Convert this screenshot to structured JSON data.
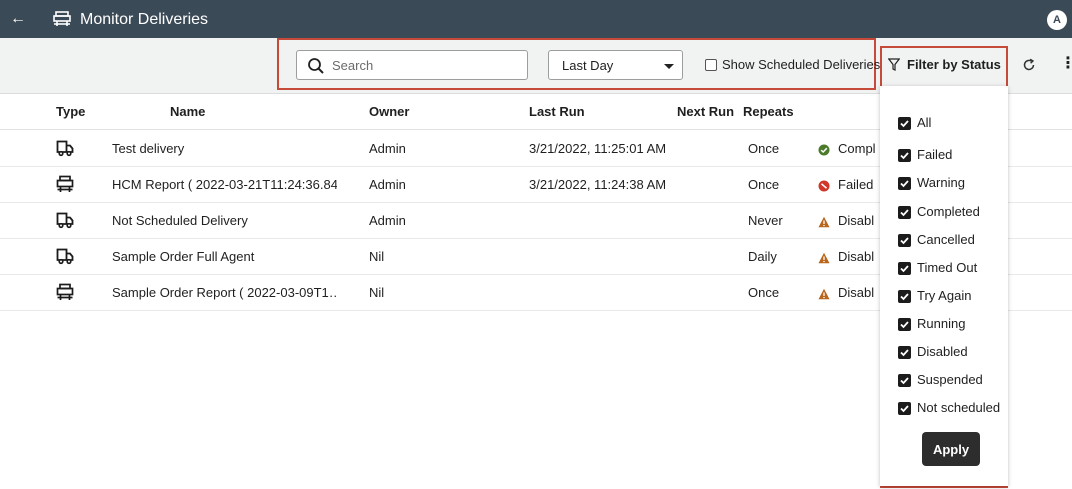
{
  "header": {
    "back_glyph": "←",
    "title": "Monitor Deliveries",
    "avatar_initial": "A"
  },
  "toolbar": {
    "search_placeholder": "Search",
    "time_range": "Last Day",
    "show_scheduled_label": "Show Scheduled Deliveries",
    "show_scheduled_checked": false,
    "filter_label": "Filter by Status",
    "more_glyph": "⋮"
  },
  "table": {
    "columns": [
      "Type",
      "Name",
      "Owner",
      "Last Run",
      "Next Run",
      "Repeats"
    ],
    "rows": [
      {
        "type_icon": "truck-icon",
        "name": "Test delivery",
        "owner": "Admin",
        "last_run": "3/21/2022, 11:25:01 AM",
        "next_run": "",
        "repeats": "Once",
        "status": "Compl",
        "status_icon": "check-circle-icon",
        "status_color": "#4a7a2a"
      },
      {
        "type_icon": "report-icon",
        "name": "HCM Report ( 2022-03-21T11:24:36.84…",
        "owner": "Admin",
        "last_run": "3/21/2022, 11:24:38 AM",
        "next_run": "",
        "repeats": "Once",
        "status": "Failed",
        "status_icon": "error-circle-icon",
        "status_color": "#d1362a"
      },
      {
        "type_icon": "truck-icon",
        "name": "Not Scheduled Delivery",
        "owner": "Admin",
        "last_run": "",
        "next_run": "",
        "repeats": "Never",
        "status": "Disabl",
        "status_icon": "warning-icon",
        "status_color": "#b8661b"
      },
      {
        "type_icon": "truck-icon",
        "name": "Sample Order Full Agent",
        "owner": "Nil",
        "last_run": "",
        "next_run": "",
        "repeats": "Daily",
        "status": "Disabl",
        "status_icon": "warning-icon",
        "status_color": "#b8661b"
      },
      {
        "type_icon": "report-icon",
        "name": "Sample Order Report ( 2022-03-09T1…",
        "owner": "Nil",
        "last_run": "",
        "next_run": "",
        "repeats": "Once",
        "status": "Disabl",
        "status_icon": "warning-icon",
        "status_color": "#b8661b"
      }
    ]
  },
  "filter_menu": {
    "options": [
      {
        "label": "All",
        "checked": true
      },
      {
        "label": "Failed",
        "checked": true
      },
      {
        "label": "Warning",
        "checked": true
      },
      {
        "label": "Completed",
        "checked": true
      },
      {
        "label": "Cancelled",
        "checked": true
      },
      {
        "label": "Timed Out",
        "checked": true
      },
      {
        "label": "Try Again",
        "checked": true
      },
      {
        "label": "Running",
        "checked": true
      },
      {
        "label": "Disabled",
        "checked": true
      },
      {
        "label": "Suspended",
        "checked": true
      },
      {
        "label": "Not scheduled",
        "checked": true
      }
    ],
    "apply_label": "Apply"
  },
  "colors": {
    "header_bg": "#3b4a57",
    "highlight": "#c64a3a",
    "toolbar_bg": "#f1f2f2"
  }
}
